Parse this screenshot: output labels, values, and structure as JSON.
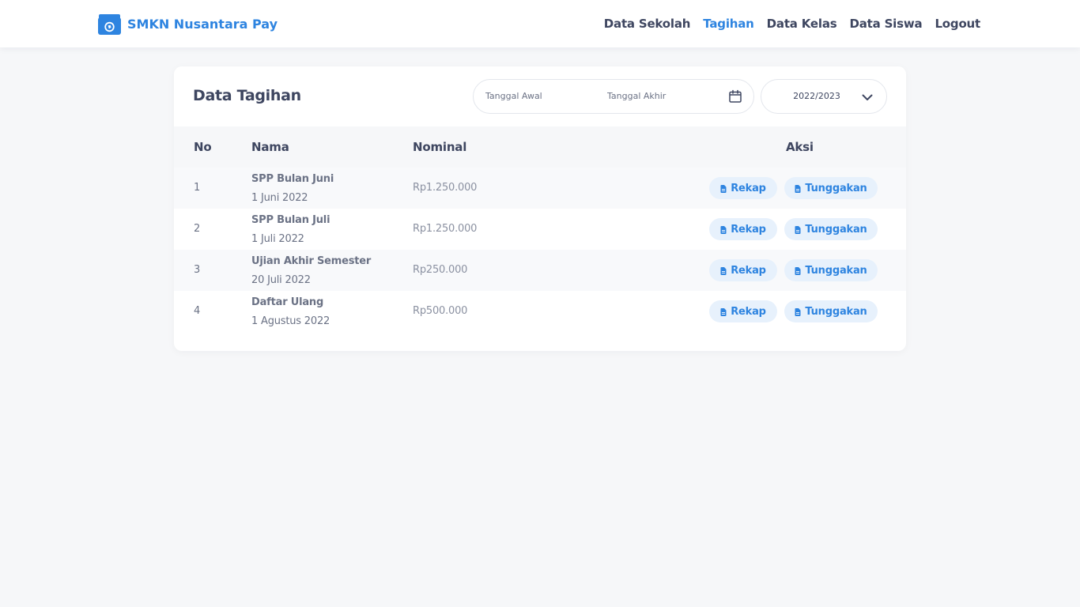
{
  "brand": {
    "name": "SMKN Nusantara Pay",
    "icon": "wallet-icon",
    "color": "#2e84e0"
  },
  "nav": {
    "items": [
      {
        "label": "Data Sekolah",
        "active": false
      },
      {
        "label": "Tagihan",
        "active": true
      },
      {
        "label": "Data Kelas",
        "active": false
      },
      {
        "label": "Data Siswa",
        "active": false
      },
      {
        "label": "Logout",
        "active": false
      }
    ]
  },
  "page": {
    "title": "Data Tagihan",
    "filters": {
      "start_placeholder": "Tanggal Awal",
      "end_placeholder": "Tanggal Akhir",
      "calendar_icon": "calendar-icon",
      "year_selected": "2022/2023",
      "year_icon": "chevron-down-icon"
    }
  },
  "table": {
    "headers": {
      "no": "No",
      "nama": "Nama",
      "nominal": "Nominal",
      "aksi": "Aksi"
    },
    "rows": [
      {
        "no": "1",
        "name": "SPP Bulan Juni",
        "date": "1 Juni 2022",
        "nominal": "Rp1.250.000",
        "rekap": "Rekap",
        "tunggakan": "Tunggakan"
      },
      {
        "no": "2",
        "name": "SPP Bulan Juli",
        "date": "1 Juli 2022",
        "nominal": "Rp1.250.000",
        "rekap": "Rekap",
        "tunggakan": "Tunggakan"
      },
      {
        "no": "3",
        "name": "Ujian Akhir Semester",
        "date": "20 Juli 2022",
        "nominal": "Rp250.000",
        "rekap": "Rekap",
        "tunggakan": "Tunggakan"
      },
      {
        "no": "4",
        "name": "Daftar Ulang",
        "date": "1 Agustus 2022",
        "nominal": "Rp500.000",
        "rekap": "Rekap",
        "tunggakan": "Tunggakan"
      }
    ],
    "button_icon": "file-icon"
  }
}
